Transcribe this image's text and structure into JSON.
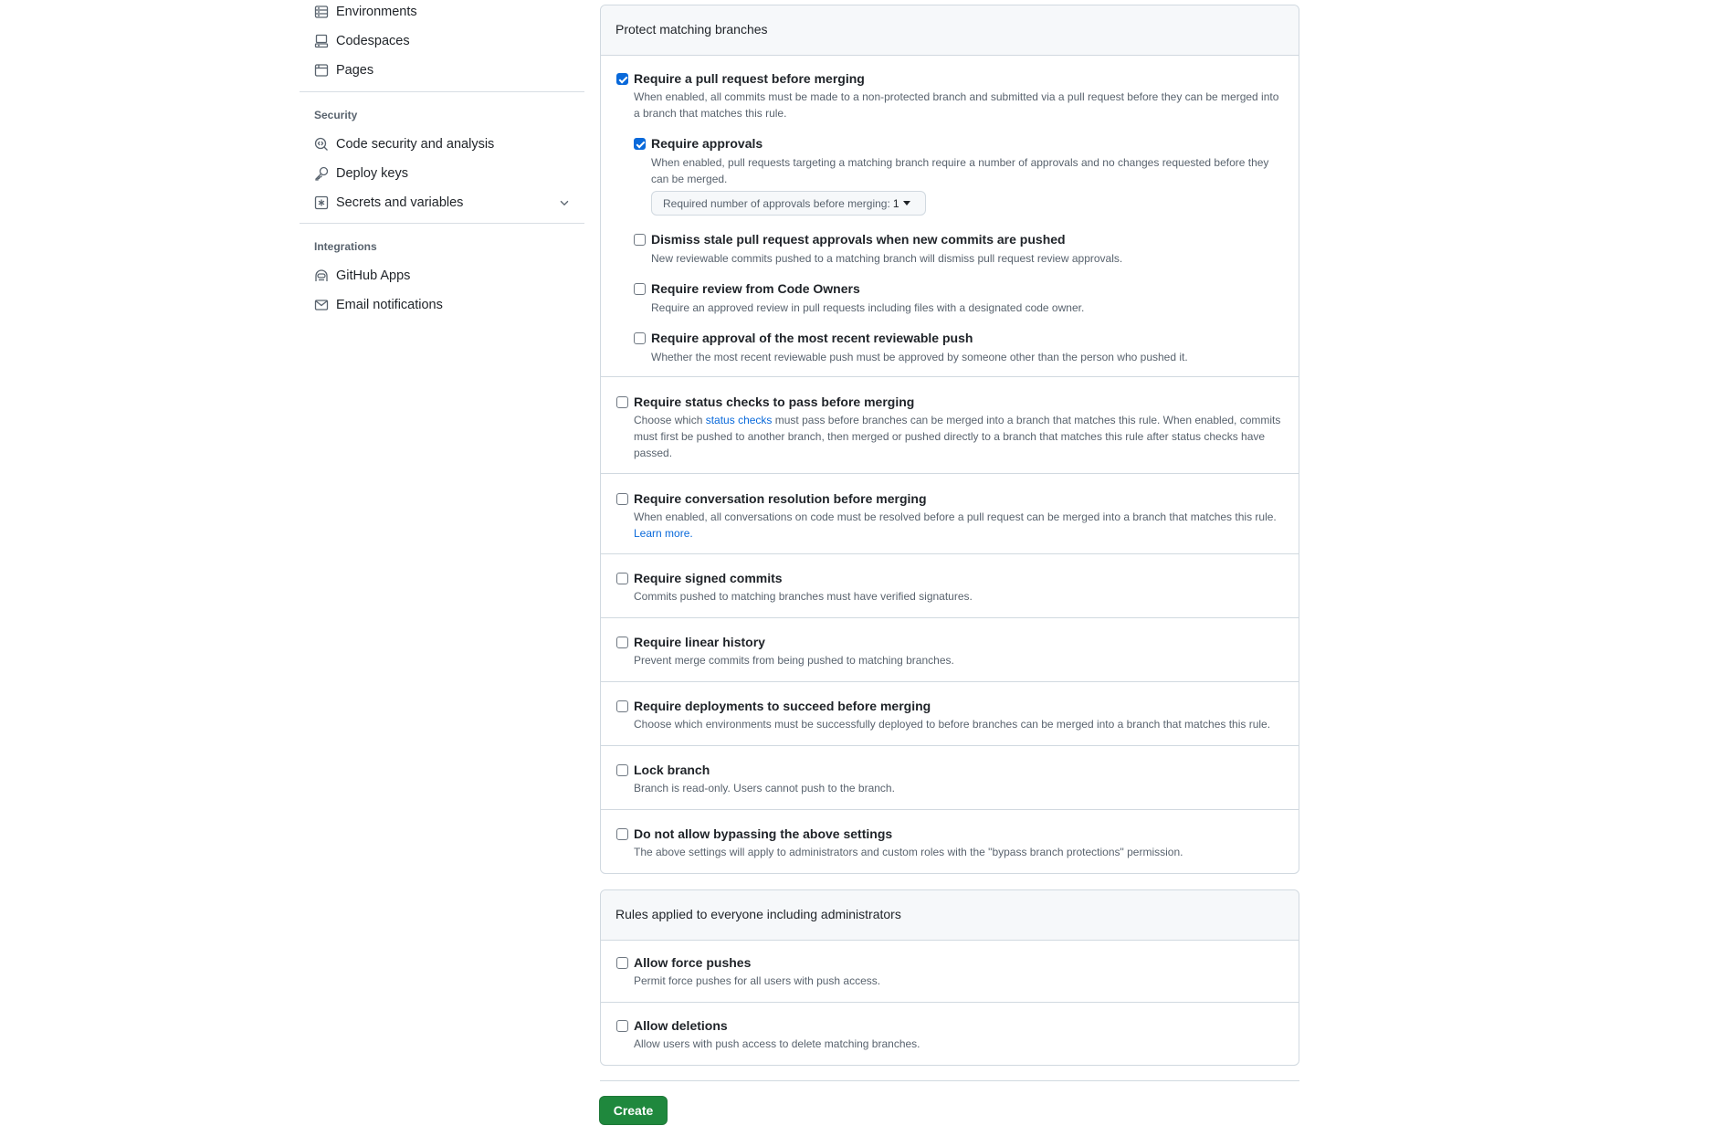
{
  "sidebar": {
    "items_top": [
      {
        "label": "Environments",
        "icon": "server-icon"
      },
      {
        "label": "Codespaces",
        "icon": "codespaces-icon"
      },
      {
        "label": "Pages",
        "icon": "browser-icon"
      }
    ],
    "security_heading": "Security",
    "security_items": [
      {
        "label": "Code security and analysis",
        "icon": "codescan-icon"
      },
      {
        "label": "Deploy keys",
        "icon": "key-icon"
      },
      {
        "label": "Secrets and variables",
        "icon": "key-asterisk-icon",
        "expandable": true
      }
    ],
    "integrations_heading": "Integrations",
    "integrations_items": [
      {
        "label": "GitHub Apps",
        "icon": "apps-icon"
      },
      {
        "label": "Email notifications",
        "icon": "mail-icon"
      }
    ]
  },
  "protect": {
    "header": "Protect matching branches",
    "require_pr": {
      "title": "Require a pull request before merging",
      "desc": "When enabled, all commits must be made to a non-protected branch and submitted via a pull request before they can be merged into a branch that matches this rule.",
      "checked": true
    },
    "require_approvals": {
      "title": "Require approvals",
      "desc": "When enabled, pull requests targeting a matching branch require a number of approvals and no changes requested before they can be merged.",
      "checked": true,
      "select_label": "Required number of approvals before merging:",
      "select_value": "1"
    },
    "dismiss_stale": {
      "title": "Dismiss stale pull request approvals when new commits are pushed",
      "desc": "New reviewable commits pushed to a matching branch will dismiss pull request review approvals.",
      "checked": false
    },
    "code_owners": {
      "title": "Require review from Code Owners",
      "desc": "Require an approved review in pull requests including files with a designated code owner.",
      "checked": false
    },
    "recent_push": {
      "title": "Require approval of the most recent reviewable push",
      "desc": "Whether the most recent reviewable push must be approved by someone other than the person who pushed it.",
      "checked": false
    },
    "status_checks": {
      "title": "Require status checks to pass before merging",
      "desc_before": "Choose which ",
      "desc_link": "status checks",
      "desc_after": " must pass before branches can be merged into a branch that matches this rule. When enabled, commits must first be pushed to another branch, then merged or pushed directly to a branch that matches this rule after status checks have passed.",
      "checked": false
    },
    "conversation": {
      "title": "Require conversation resolution before merging",
      "desc": "When enabled, all conversations on code must be resolved before a pull request can be merged into a branch that matches this rule.",
      "link": "Learn more.",
      "checked": false
    },
    "signed_commits": {
      "title": "Require signed commits",
      "desc": "Commits pushed to matching branches must have verified signatures.",
      "checked": false
    },
    "linear_history": {
      "title": "Require linear history",
      "desc": "Prevent merge commits from being pushed to matching branches.",
      "checked": false
    },
    "deployments": {
      "title": "Require deployments to succeed before merging",
      "desc": "Choose which environments must be successfully deployed to before branches can be merged into a branch that matches this rule.",
      "checked": false
    },
    "lock_branch": {
      "title": "Lock branch",
      "desc": "Branch is read-only. Users cannot push to the branch.",
      "checked": false
    },
    "no_bypass": {
      "title": "Do not allow bypassing the above settings",
      "desc": "The above settings will apply to administrators and custom roles with the \"bypass branch protections\" permission.",
      "checked": false
    }
  },
  "everyone": {
    "header": "Rules applied to everyone including administrators",
    "force_pushes": {
      "title": "Allow force pushes",
      "desc": "Permit force pushes for all users with push access.",
      "checked": false
    },
    "deletions": {
      "title": "Allow deletions",
      "desc": "Allow users with push access to delete matching branches.",
      "checked": false
    }
  },
  "actions": {
    "create_label": "Create"
  },
  "colors": {
    "accent": "#0969da",
    "primary_button": "#1f883d",
    "muted_text": "#59636e",
    "border": "#d1d9e0"
  }
}
